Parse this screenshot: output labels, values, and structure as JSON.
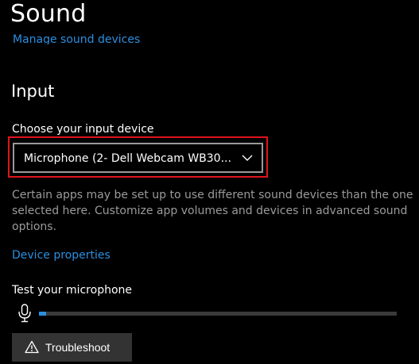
{
  "header": {
    "title": "Sound",
    "manage_link": "Manage sound devices"
  },
  "input": {
    "heading": "Input",
    "choose_label": "Choose your input device",
    "selected_device": "Microphone (2- Dell Webcam WB30...",
    "description": "Certain apps may be set up to use different sound devices than the one selected here. Customize app volumes and devices in advanced sound options.",
    "device_properties": "Device properties",
    "test_label": "Test your microphone",
    "mic_level_percent": 2,
    "troubleshoot_label": "Troubleshoot"
  },
  "icons": {
    "dropdown": "chevron-down-icon",
    "microphone": "microphone-icon",
    "troubleshoot": "warning-icon"
  },
  "colors": {
    "background": "#000000",
    "accent": "#2b8fe0",
    "highlight": "#e0141e",
    "button": "#333333",
    "secondary_text": "#9b9b9b"
  }
}
